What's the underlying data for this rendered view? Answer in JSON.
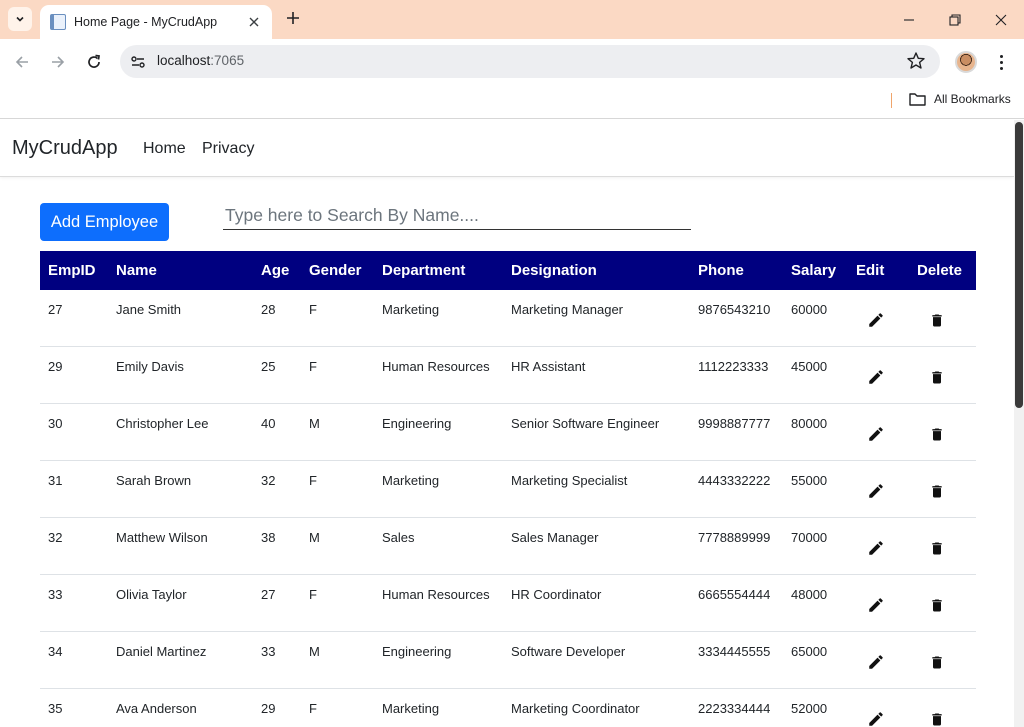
{
  "browser": {
    "tab_title": "Home Page - MyCrudApp",
    "url_host": "localhost",
    "url_port": ":7065",
    "bookmarks_label": "All Bookmarks"
  },
  "app": {
    "brand": "MyCrudApp",
    "nav": [
      {
        "label": "Home"
      },
      {
        "label": "Privacy"
      }
    ],
    "add_button_label": "Add Employee",
    "search_placeholder": "Type here to Search By Name....",
    "header_color": "#000080",
    "button_color": "#0d6efd"
  },
  "table": {
    "columns": [
      "EmpID",
      "Name",
      "Age",
      "Gender",
      "Department",
      "Designation",
      "Phone",
      "Salary",
      "Edit",
      "Delete"
    ],
    "rows": [
      {
        "id": "27",
        "name": "Jane Smith",
        "age": "28",
        "gender": "F",
        "department": "Marketing",
        "designation": "Marketing Manager",
        "phone": "9876543210",
        "salary": "60000"
      },
      {
        "id": "29",
        "name": "Emily Davis",
        "age": "25",
        "gender": "F",
        "department": "Human Resources",
        "designation": "HR Assistant",
        "phone": "1112223333",
        "salary": "45000"
      },
      {
        "id": "30",
        "name": "Christopher Lee",
        "age": "40",
        "gender": "M",
        "department": "Engineering",
        "designation": "Senior Software Engineer",
        "phone": "9998887777",
        "salary": "80000"
      },
      {
        "id": "31",
        "name": "Sarah Brown",
        "age": "32",
        "gender": "F",
        "department": "Marketing",
        "designation": "Marketing Specialist",
        "phone": "4443332222",
        "salary": "55000"
      },
      {
        "id": "32",
        "name": "Matthew Wilson",
        "age": "38",
        "gender": "M",
        "department": "Sales",
        "designation": "Sales Manager",
        "phone": "7778889999",
        "salary": "70000"
      },
      {
        "id": "33",
        "name": "Olivia Taylor",
        "age": "27",
        "gender": "F",
        "department": "Human Resources",
        "designation": "HR Coordinator",
        "phone": "6665554444",
        "salary": "48000"
      },
      {
        "id": "34",
        "name": "Daniel Martinez",
        "age": "33",
        "gender": "M",
        "department": "Engineering",
        "designation": "Software Developer",
        "phone": "3334445555",
        "salary": "65000"
      },
      {
        "id": "35",
        "name": "Ava Anderson",
        "age": "29",
        "gender": "F",
        "department": "Marketing",
        "designation": "Marketing Coordinator",
        "phone": "2223334444",
        "salary": "52000"
      }
    ],
    "row_icons": {
      "edit": "pencil-icon",
      "delete": "trash-icon"
    }
  }
}
